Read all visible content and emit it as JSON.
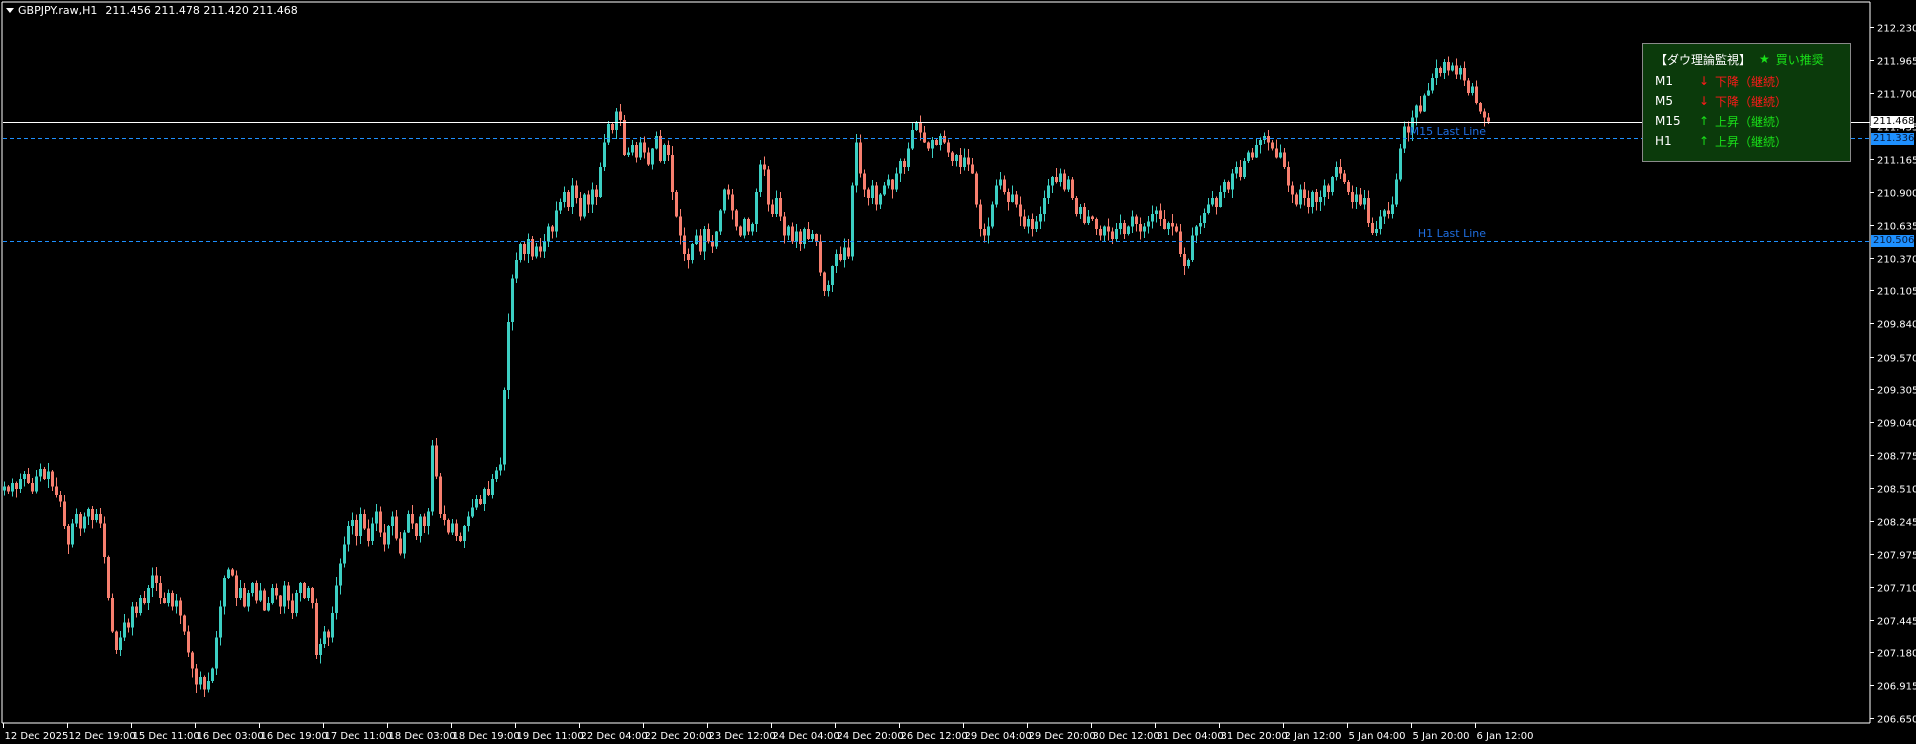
{
  "header": {
    "symbol": "GBPJPY.raw,H1",
    "ohlc": "211.456 211.478 211.420 211.468"
  },
  "colors": {
    "background": "#000000",
    "bull": "#3ccfc3",
    "bear": "#f77f6f",
    "frame": "#ffffff",
    "level_line": "#1e90ff",
    "panel_bg": "#0b3a0b",
    "down": "#ff1a1a",
    "up": "#19e019"
  },
  "panel": {
    "title": "【ダウ理論監視】",
    "signal_icon": "star-icon",
    "signal_star": "★",
    "signal": "買い推奨",
    "rows": [
      {
        "tf": "M1",
        "arrow": "↓",
        "state": "下降（継続）",
        "dir": "down"
      },
      {
        "tf": "M5",
        "arrow": "↓",
        "state": "下降（継続）",
        "dir": "down"
      },
      {
        "tf": "M15",
        "arrow": "↑",
        "state": "上昇（継続）",
        "dir": "up"
      },
      {
        "tf": "H1",
        "arrow": "↑",
        "state": "上昇（継続）",
        "dir": "up"
      }
    ]
  },
  "lines": {
    "bid": {
      "price": 211.468,
      "tag": "211.468"
    },
    "m15": {
      "price": 211.336,
      "tag": "211.336",
      "label": "M15 Last Line"
    },
    "h1": {
      "price": 210.506,
      "tag": "210.506",
      "label": "H1 Last Line"
    }
  },
  "chart_data": {
    "type": "candlestick",
    "symbol": "GBPJPY.raw",
    "timeframe": "H1",
    "ylim": [
      206.61,
      212.41
    ],
    "price_ticks": [
      "212.230",
      "211.965",
      "211.700",
      "211.435",
      "211.165",
      "210.900",
      "210.635",
      "210.370",
      "210.105",
      "209.840",
      "209.570",
      "209.305",
      "209.040",
      "208.775",
      "208.510",
      "208.245",
      "207.975",
      "207.710",
      "207.445",
      "207.180",
      "206.915",
      "206.650"
    ],
    "time_ticks": [
      "12 Dec 2025",
      "12 Dec 19:00",
      "15 Dec 11:00",
      "16 Dec 03:00",
      "16 Dec 19:00",
      "17 Dec 11:00",
      "18 Dec 03:00",
      "18 Dec 19:00",
      "19 Dec 11:00",
      "22 Dec 04:00",
      "22 Dec 20:00",
      "23 Dec 12:00",
      "24 Dec 04:00",
      "24 Dec 20:00",
      "26 Dec 12:00",
      "29 Dec 04:00",
      "29 Dec 20:00",
      "30 Dec 12:00",
      "31 Dec 04:00",
      "31 Dec 20:00",
      "2 Jan 12:00",
      "5 Jan 04:00",
      "5 Jan 20:00",
      "6 Jan 12:00"
    ],
    "bars_per_time_tick": 16,
    "close": [
      208.52,
      208.48,
      208.55,
      208.5,
      208.58,
      208.62,
      208.55,
      208.48,
      208.6,
      208.66,
      208.58,
      208.64,
      208.52,
      208.45,
      208.4,
      208.2,
      208.05,
      208.22,
      208.3,
      208.18,
      208.28,
      208.34,
      208.25,
      208.3,
      208.22,
      207.95,
      207.62,
      207.35,
      207.2,
      207.3,
      207.42,
      207.38,
      207.55,
      207.5,
      207.62,
      207.58,
      207.7,
      207.8,
      207.74,
      207.62,
      207.58,
      207.66,
      207.55,
      207.6,
      207.48,
      207.35,
      207.18,
      207.05,
      206.92,
      206.98,
      206.88,
      206.95,
      207.05,
      207.3,
      207.55,
      207.78,
      207.85,
      207.8,
      207.62,
      207.7,
      207.55,
      207.66,
      207.74,
      207.6,
      207.68,
      207.52,
      207.58,
      207.7,
      207.64,
      207.55,
      207.72,
      207.6,
      207.5,
      207.66,
      207.74,
      207.62,
      207.7,
      207.58,
      207.16,
      207.25,
      207.35,
      207.3,
      207.5,
      207.72,
      207.9,
      208.05,
      208.2,
      208.25,
      208.12,
      208.3,
      208.18,
      208.08,
      208.22,
      208.32,
      208.15,
      208.05,
      208.2,
      208.28,
      208.1,
      207.98,
      208.15,
      208.3,
      208.22,
      208.12,
      208.28,
      208.2,
      208.32,
      208.85,
      208.6,
      208.3,
      208.25,
      208.15,
      208.22,
      208.12,
      208.08,
      208.2,
      208.28,
      208.35,
      208.42,
      208.38,
      208.5,
      208.45,
      208.58,
      208.65,
      208.7,
      209.3,
      209.85,
      210.2,
      210.35,
      210.48,
      210.4,
      210.52,
      210.38,
      210.46,
      210.42,
      210.5,
      210.62,
      210.58,
      210.75,
      210.82,
      210.9,
      210.78,
      210.95,
      210.85,
      210.7,
      210.88,
      210.8,
      210.92,
      210.86,
      211.1,
      211.3,
      211.45,
      211.4,
      211.55,
      211.48,
      211.2,
      211.22,
      211.28,
      211.18,
      211.3,
      211.22,
      211.12,
      211.25,
      211.35,
      211.15,
      211.28,
      211.2,
      210.9,
      210.7,
      210.55,
      210.4,
      210.35,
      210.48,
      210.55,
      210.42,
      210.6,
      210.5,
      210.46,
      210.58,
      210.75,
      210.92,
      210.88,
      210.75,
      210.62,
      210.55,
      210.68,
      210.58,
      210.64,
      210.9,
      211.12,
      211.08,
      210.8,
      210.72,
      210.85,
      210.7,
      210.55,
      210.62,
      210.5,
      210.58,
      210.48,
      210.6,
      210.52,
      210.56,
      210.5,
      210.25,
      210.1,
      210.15,
      210.3,
      210.4,
      210.35,
      210.45,
      210.38,
      210.95,
      211.3,
      211.05,
      210.92,
      210.85,
      210.95,
      210.8,
      210.88,
      210.95,
      211.0,
      210.92,
      211.05,
      211.15,
      211.1,
      211.25,
      211.4,
      211.46,
      211.38,
      211.3,
      211.25,
      211.32,
      211.28,
      211.35,
      211.3,
      211.22,
      211.15,
      211.2,
      211.1,
      211.18,
      211.12,
      211.05,
      210.8,
      210.6,
      210.55,
      210.62,
      210.8,
      210.95,
      211.0,
      210.9,
      210.82,
      210.88,
      210.8,
      210.7,
      210.62,
      210.68,
      210.6,
      210.66,
      210.72,
      210.85,
      210.95,
      211.02,
      210.98,
      211.05,
      210.92,
      211.0,
      210.85,
      210.72,
      210.78,
      210.65,
      210.7,
      210.68,
      210.6,
      210.55,
      210.62,
      210.58,
      210.52,
      210.6,
      210.65,
      210.56,
      210.62,
      210.7,
      210.64,
      210.58,
      210.62,
      210.66,
      210.72,
      210.75,
      210.68,
      210.6,
      210.65,
      210.62,
      210.58,
      210.4,
      210.3,
      210.35,
      210.55,
      210.62,
      210.65,
      210.73,
      210.8,
      210.85,
      210.78,
      210.9,
      210.98,
      210.92,
      211.05,
      211.1,
      211.02,
      211.15,
      211.22,
      211.18,
      211.28,
      211.32,
      211.35,
      211.3,
      211.25,
      211.18,
      211.22,
      211.1,
      210.95,
      210.88,
      210.8,
      210.92,
      210.85,
      210.78,
      210.9,
      210.82,
      210.86,
      210.95,
      210.9,
      211.02,
      211.1,
      211.05,
      210.98,
      210.9,
      210.82,
      210.88,
      210.8,
      210.85,
      210.65,
      210.57,
      210.6,
      210.7,
      210.75,
      210.72,
      210.8,
      211.0,
      211.25,
      211.43,
      211.38,
      211.5,
      211.6,
      211.55,
      211.68,
      211.72,
      211.82,
      211.9,
      211.86,
      211.95,
      211.88,
      211.92,
      211.85,
      211.9,
      211.8,
      211.7,
      211.75,
      211.62,
      211.55,
      211.5,
      211.468
    ]
  }
}
